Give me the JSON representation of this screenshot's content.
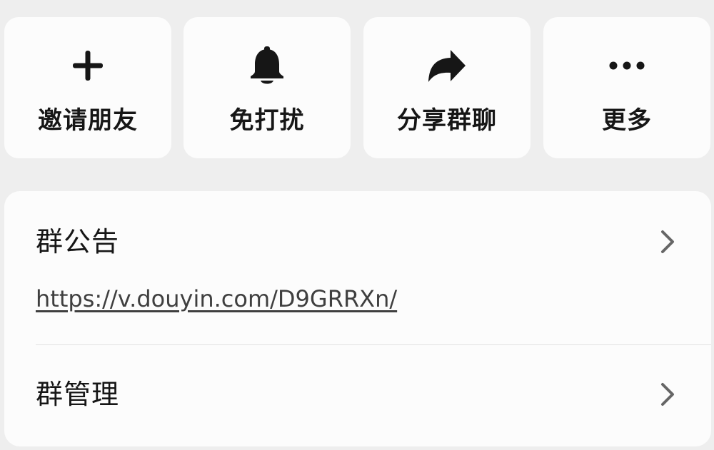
{
  "actions": [
    {
      "label": "邀请朋友",
      "icon": "plus-icon"
    },
    {
      "label": "免打扰",
      "icon": "bell-icon"
    },
    {
      "label": "分享群聊",
      "icon": "share-arrow-icon"
    },
    {
      "label": "更多",
      "icon": "more-dots-icon"
    }
  ],
  "announcement": {
    "title": "群公告",
    "link": "https://v.douyin.com/D9GRRXn/"
  },
  "management": {
    "title": "群管理"
  },
  "colors": {
    "page_background": "#eeeeee",
    "card_background": "#fcfcfc",
    "text": "#161616",
    "chevron": "#666666",
    "divider": "#e2e2e2"
  }
}
